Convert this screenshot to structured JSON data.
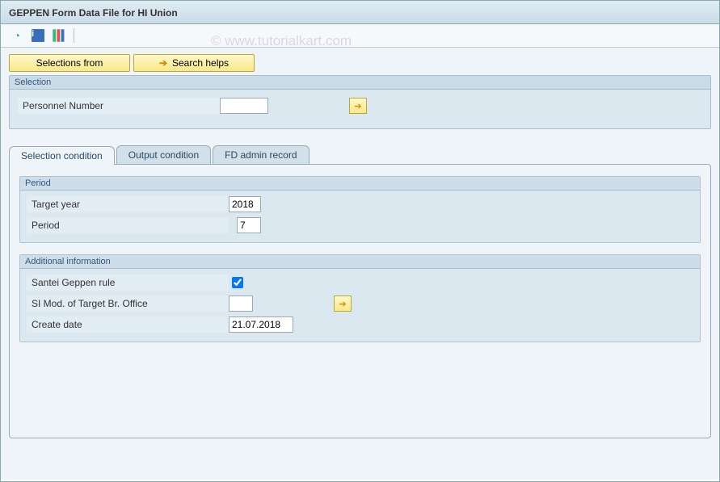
{
  "title": "GEPPEN Form Data File for HI Union",
  "watermark": "© www.tutorialkart.com",
  "toolbar": {
    "selections_from": "Selections from",
    "search_helps": "Search helps"
  },
  "selection_group": {
    "title": "Selection",
    "personnel_number_label": "Personnel Number",
    "personnel_number_value": ""
  },
  "tabs": {
    "selection_condition": "Selection condition",
    "output_condition": "Output condition",
    "fd_admin_record": "FD admin record"
  },
  "period_group": {
    "title": "Period",
    "target_year_label": "Target year",
    "target_year_value": "2018",
    "period_label": "Period",
    "period_value": "7"
  },
  "additional_group": {
    "title": "Additional information",
    "santei_label": "Santei Geppen rule",
    "santei_checked": true,
    "si_mod_label": "SI Mod. of Target Br. Office",
    "si_mod_value": "",
    "create_date_label": "Create date",
    "create_date_value": "21.07.2018"
  }
}
